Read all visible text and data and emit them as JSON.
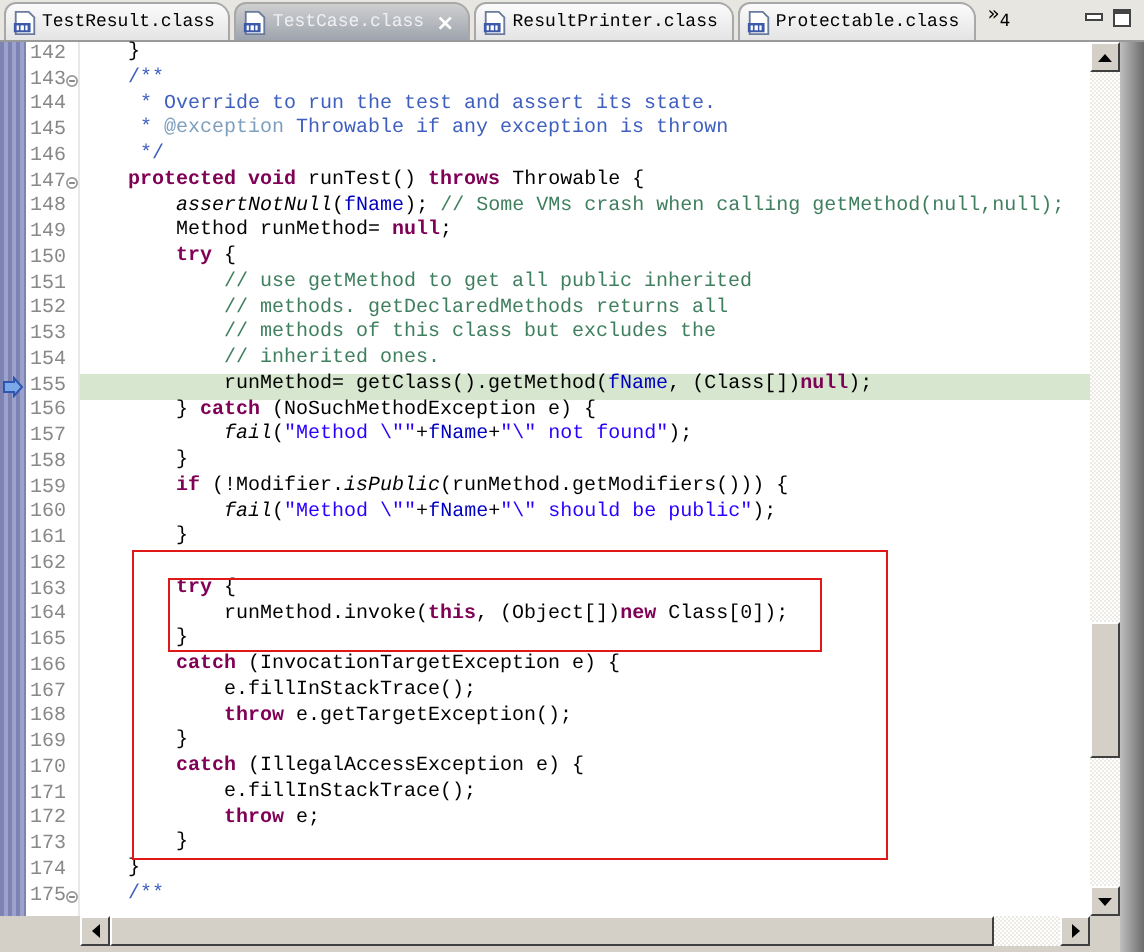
{
  "tabs": [
    {
      "label": "TestResult.class",
      "selected": false
    },
    {
      "label": "TestCase.class",
      "selected": true,
      "close": "×"
    },
    {
      "label": "ResultPrinter.class",
      "selected": false
    },
    {
      "label": "Protectable.class",
      "selected": false
    }
  ],
  "tab_overflow": "»$_{4}$",
  "lines": [
    {
      "number": "142",
      "tokens": [
        {
          "kind": "plain",
          "text": "    }"
        }
      ]
    },
    {
      "number": "143",
      "fold": true,
      "tokens": [
        {
          "kind": "doc",
          "text": "    /**"
        }
      ]
    },
    {
      "number": "144",
      "tokens": [
        {
          "kind": "doc",
          "text": "     * Override to run the test and assert its state."
        }
      ]
    },
    {
      "number": "145",
      "tokens": [
        {
          "kind": "doc",
          "text": "     *"
        },
        {
          "kind": "doctag",
          "text": " @exception"
        },
        {
          "kind": "doc",
          "text": " Throwable if any exception is thrown"
        }
      ]
    },
    {
      "number": "146",
      "tokens": [
        {
          "kind": "doc",
          "text": "     */"
        }
      ]
    },
    {
      "number": "147",
      "fold": true,
      "tokens": [
        {
          "kind": "keyword",
          "text": "    protected"
        },
        {
          "kind": "keyword",
          "text": " void"
        },
        {
          "kind": "plain",
          "text": " runTest() "
        },
        {
          "kind": "keyword",
          "text": "throws"
        },
        {
          "kind": "plain",
          "text": " Throwable {"
        }
      ]
    },
    {
      "number": "148",
      "tokens": [
        {
          "kind": "static",
          "text": "        assertNotNull"
        },
        {
          "kind": "plain",
          "text": "("
        },
        {
          "kind": "field",
          "text": "fName"
        },
        {
          "kind": "plain",
          "text": "); "
        },
        {
          "kind": "comment",
          "text": "// Some VMs crash when calling getMethod(null,null);"
        }
      ]
    },
    {
      "number": "149",
      "tokens": [
        {
          "kind": "plain",
          "text": "        Method runMethod= "
        },
        {
          "kind": "keyword",
          "text": "null"
        },
        {
          "kind": "plain",
          "text": ";"
        }
      ]
    },
    {
      "number": "150",
      "tokens": [
        {
          "kind": "keyword",
          "text": "        try"
        },
        {
          "kind": "plain",
          "text": " {"
        }
      ]
    },
    {
      "number": "151",
      "tokens": [
        {
          "kind": "comment",
          "text": "            // use getMethod to get all public inherited"
        }
      ]
    },
    {
      "number": "152",
      "tokens": [
        {
          "kind": "comment",
          "text": "            // methods. getDeclaredMethods returns all"
        }
      ]
    },
    {
      "number": "153",
      "tokens": [
        {
          "kind": "comment",
          "text": "            // methods of this class but excludes the"
        }
      ]
    },
    {
      "number": "154",
      "tokens": [
        {
          "kind": "comment",
          "text": "            // inherited ones."
        }
      ]
    },
    {
      "number": "155",
      "current": true,
      "tokens": [
        {
          "kind": "plain",
          "text": "            runMethod= getClass().getMethod("
        },
        {
          "kind": "field",
          "text": "fName"
        },
        {
          "kind": "plain",
          "text": ", (Class[])"
        },
        {
          "kind": "keyword",
          "text": "null"
        },
        {
          "kind": "plain",
          "text": ");"
        }
      ]
    },
    {
      "number": "156",
      "tokens": [
        {
          "kind": "plain",
          "text": "        } "
        },
        {
          "kind": "keyword",
          "text": "catch"
        },
        {
          "kind": "plain",
          "text": " (NoSuchMethodException e) {"
        }
      ]
    },
    {
      "number": "157",
      "tokens": [
        {
          "kind": "static",
          "text": "            fail"
        },
        {
          "kind": "plain",
          "text": "("
        },
        {
          "kind": "string",
          "text": "\"Method \\\"\""
        },
        {
          "kind": "plain",
          "text": "+"
        },
        {
          "kind": "field",
          "text": "fName"
        },
        {
          "kind": "plain",
          "text": "+"
        },
        {
          "kind": "string",
          "text": "\"\\\" not found\""
        },
        {
          "kind": "plain",
          "text": ");"
        }
      ]
    },
    {
      "number": "158",
      "tokens": [
        {
          "kind": "plain",
          "text": "        }"
        }
      ]
    },
    {
      "number": "159",
      "tokens": [
        {
          "kind": "keyword",
          "text": "        if"
        },
        {
          "kind": "plain",
          "text": " (!Modifier."
        },
        {
          "kind": "static",
          "text": "isPublic"
        },
        {
          "kind": "plain",
          "text": "(runMethod.getModifiers())) {"
        }
      ]
    },
    {
      "number": "160",
      "tokens": [
        {
          "kind": "static",
          "text": "            fail"
        },
        {
          "kind": "plain",
          "text": "("
        },
        {
          "kind": "string",
          "text": "\"Method \\\"\""
        },
        {
          "kind": "plain",
          "text": "+"
        },
        {
          "kind": "field",
          "text": "fName"
        },
        {
          "kind": "plain",
          "text": "+"
        },
        {
          "kind": "string",
          "text": "\"\\\" should be public\""
        },
        {
          "kind": "plain",
          "text": ");"
        }
      ]
    },
    {
      "number": "161",
      "tokens": [
        {
          "kind": "plain",
          "text": "        }"
        }
      ]
    },
    {
      "number": "162",
      "outer_frame": true
    },
    {
      "number": "163",
      "outer_frame": true,
      "inner_frame": true,
      "tokens": [
        {
          "kind": "keyword",
          "text": "        try"
        },
        {
          "kind": "plain",
          "text": " {"
        }
      ]
    },
    {
      "number": "164",
      "outer_frame": true,
      "inner_frame": true,
      "tokens": [
        {
          "kind": "plain",
          "text": "            runMethod.invoke("
        },
        {
          "kind": "keyword",
          "text": "this"
        },
        {
          "kind": "plain",
          "text": ", (Object[])"
        },
        {
          "kind": "keyword",
          "text": "new"
        },
        {
          "kind": "plain",
          "text": " Class[0]);"
        }
      ]
    },
    {
      "number": "165",
      "outer_frame": true,
      "inner_frame": true,
      "tokens": [
        {
          "kind": "plain",
          "text": "        }"
        }
      ]
    },
    {
      "number": "166",
      "outer_frame": true,
      "tokens": [
        {
          "kind": "keyword",
          "text": "        catch"
        },
        {
          "kind": "plain",
          "text": " (InvocationTargetException e) {"
        }
      ]
    },
    {
      "number": "167",
      "outer_frame": true,
      "tokens": [
        {
          "kind": "plain",
          "text": "            e.fillInStackTrace();"
        }
      ]
    },
    {
      "number": "168",
      "outer_frame": true,
      "tokens": [
        {
          "kind": "keyword",
          "text": "            throw"
        },
        {
          "kind": "plain",
          "text": " e.getTargetException();"
        }
      ]
    },
    {
      "number": "169",
      "outer_frame": true,
      "tokens": [
        {
          "kind": "plain",
          "text": "        }"
        }
      ]
    },
    {
      "number": "170",
      "outer_frame": true,
      "tokens": [
        {
          "kind": "keyword",
          "text": "        catch"
        },
        {
          "kind": "plain",
          "text": " (IllegalAccessException e) {"
        }
      ]
    },
    {
      "number": "171",
      "outer_frame": true,
      "tokens": [
        {
          "kind": "plain",
          "text": "            e.fillInStackTrace();"
        }
      ]
    },
    {
      "number": "172",
      "outer_frame": true,
      "tokens": [
        {
          "kind": "keyword",
          "text": "            throw"
        },
        {
          "kind": "plain",
          "text": " e;"
        }
      ]
    },
    {
      "number": "173",
      "outer_frame": true,
      "tokens": [
        {
          "kind": "plain",
          "text": "        }"
        }
      ]
    },
    {
      "number": "174",
      "tokens": [
        {
          "kind": "plain",
          "text": "    }"
        }
      ]
    },
    {
      "number": "175",
      "fold": true,
      "tokens": [
        {
          "kind": "doc",
          "text": "    /**"
        }
      ]
    }
  ]
}
